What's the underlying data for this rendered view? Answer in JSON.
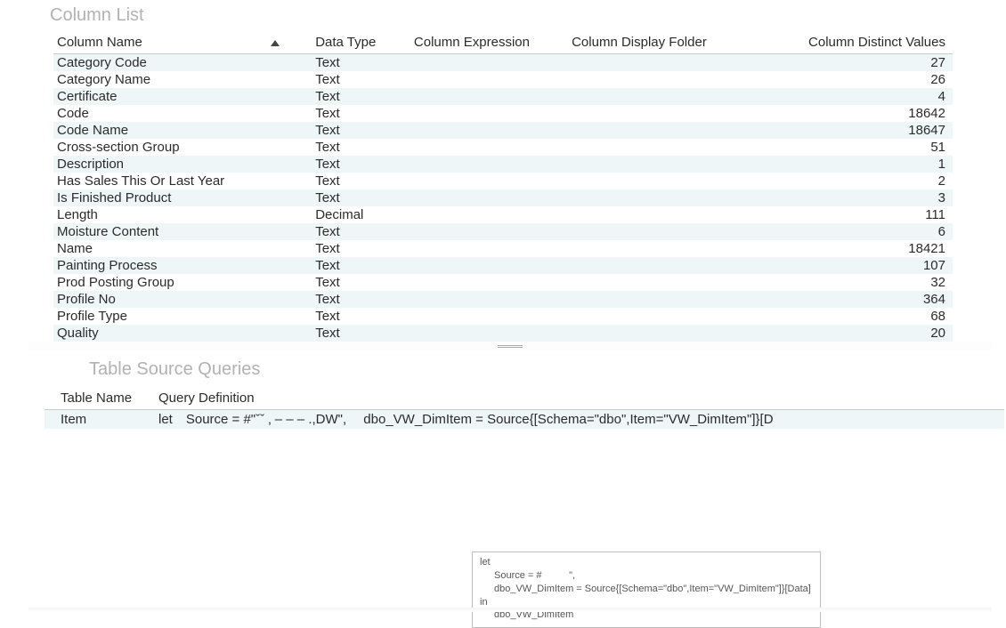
{
  "columnList": {
    "title": "Column List",
    "headers": {
      "name": "Column Name",
      "dtype": "Data Type",
      "expr": "Column Expression",
      "folder": "Column Display Folder",
      "distinct": "Column Distinct Values"
    },
    "sortColumn": "name",
    "sortDirection": "asc",
    "rows": [
      {
        "name": "Category Code",
        "dtype": "Text",
        "expr": "",
        "folder": "",
        "distinct": "27"
      },
      {
        "name": "Category Name",
        "dtype": "Text",
        "expr": "",
        "folder": "",
        "distinct": "26"
      },
      {
        "name": "Certificate",
        "dtype": "Text",
        "expr": "",
        "folder": "",
        "distinct": "4"
      },
      {
        "name": "Code",
        "dtype": "Text",
        "expr": "",
        "folder": "",
        "distinct": "18642"
      },
      {
        "name": "Code Name",
        "dtype": "Text",
        "expr": "",
        "folder": "",
        "distinct": "18647"
      },
      {
        "name": "Cross-section Group",
        "dtype": "Text",
        "expr": "",
        "folder": "",
        "distinct": "51"
      },
      {
        "name": "Description",
        "dtype": "Text",
        "expr": "",
        "folder": "",
        "distinct": "1"
      },
      {
        "name": "Has Sales This Or Last Year",
        "dtype": "Text",
        "expr": "",
        "folder": "",
        "distinct": "2"
      },
      {
        "name": "Is Finished Product",
        "dtype": "Text",
        "expr": "",
        "folder": "",
        "distinct": "3"
      },
      {
        "name": "Length",
        "dtype": "Decimal",
        "expr": "",
        "folder": "",
        "distinct": "111"
      },
      {
        "name": "Moisture Content",
        "dtype": "Text",
        "expr": "",
        "folder": "",
        "distinct": "6"
      },
      {
        "name": "Name",
        "dtype": "Text",
        "expr": "",
        "folder": "",
        "distinct": "18421"
      },
      {
        "name": "Painting Process",
        "dtype": "Text",
        "expr": "",
        "folder": "",
        "distinct": "107"
      },
      {
        "name": "Prod Posting Group",
        "dtype": "Text",
        "expr": "",
        "folder": "",
        "distinct": "32"
      },
      {
        "name": "Profile No",
        "dtype": "Text",
        "expr": "",
        "folder": "",
        "distinct": "364"
      },
      {
        "name": "Profile Type",
        "dtype": "Text",
        "expr": "",
        "folder": "",
        "distinct": "68"
      },
      {
        "name": "Quality",
        "dtype": "Text",
        "expr": "",
        "folder": "",
        "distinct": "20"
      }
    ]
  },
  "tableSourceQueries": {
    "title": "Table Source Queries",
    "headers": {
      "tableName": "Table Name",
      "queryDef": "Query Definition"
    },
    "rows": [
      {
        "tableName": "Item",
        "queryDef": "let Source = #\"ˇˇ ‚ ‒ ‒ ‒ .,DW\",  dbo_VW_DimItem = Source{[Schema=\"dbo\",Item=\"VW_DimItem\"]}[D"
      }
    ]
  },
  "tooltip": {
    "line1": "let",
    "line2": "Source = #          \",",
    "line3": "dbo_VW_DimItem = Source{[Schema=\"dbo\",Item=\"VW_DimItem\"]}[Data]",
    "line4": "in",
    "line5": "dbo_VW_DimItem"
  }
}
